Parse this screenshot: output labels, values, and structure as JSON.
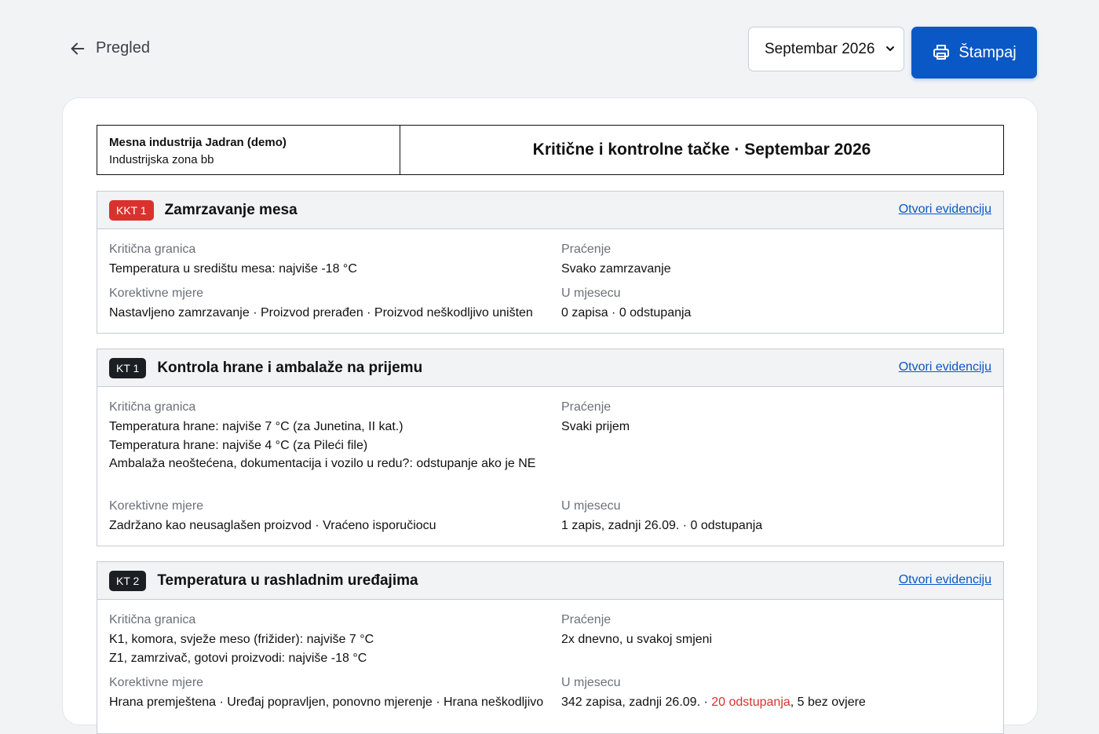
{
  "nav": {
    "back_label": "Pregled"
  },
  "month_select": {
    "value": "Septembar 2026"
  },
  "print_button": {
    "label": "Štampaj"
  },
  "document": {
    "company": "Mesna industrija Jadran (demo)",
    "address": "Industrijska zona bb",
    "title": "Kritične i kontrolne tačke · Septembar 2026"
  },
  "labels": {
    "critical_limit": "Kritična granica",
    "monitoring": "Praćenje",
    "corrective": "Korektivne mjere",
    "in_month": "U mjesecu",
    "open_records": "Otvori evidenciju"
  },
  "points": [
    {
      "code": "KKT 1",
      "badge_color": "#d9322e",
      "title": "Zamrzavanje mesa",
      "limits": [
        "Temperatura u središtu mesa: najviše -18 °C"
      ],
      "monitoring": "Svako zamrzavanje",
      "corrective": "Nastavljeno zamrzavanje · Proizvod prerađen · Proizvod neškodljivo uništen",
      "month_summary": "0 zapisa · 0 odstupanja"
    },
    {
      "code": "KT 1",
      "badge_color": "#1b1e22",
      "title": "Kontrola hrane i ambalaže na prijemu",
      "limits": [
        "Temperatura hrane: najviše 7 °C (za Junetina, II kat.)",
        "Temperatura hrane: najviše 4 °C (za Pileći file)",
        "Ambalaža neoštećena, dokumentacija i vozilo u redu?: odstupanje ako je NE"
      ],
      "monitoring": "Svaki prijem",
      "corrective": "Zadržano kao neusaglašen proizvod · Vraćeno isporučiocu",
      "month_summary": "1 zapis, zadnji 26.09. · 0 odstupanja"
    },
    {
      "code": "KT 2",
      "badge_color": "#1b1e22",
      "title": "Temperatura u rashladnim uređajima",
      "limits": [
        "K1, komora, svježe meso (frižider): najviše 7 °C",
        "Z1, zamrzivač, gotovi proizvodi: najviše -18 °C"
      ],
      "monitoring": "2x dnevno, u svakoj smjeni",
      "corrective": "Hrana premještena · Uređaj popravljen, ponovno mjerenje · Hrana neškodljivo",
      "month_summary_parts": {
        "a": "342 zapisa, zadnji 26.09. · ",
        "b": "20 odstupanja",
        "c": ", 5 bez ovjere"
      }
    }
  ]
}
